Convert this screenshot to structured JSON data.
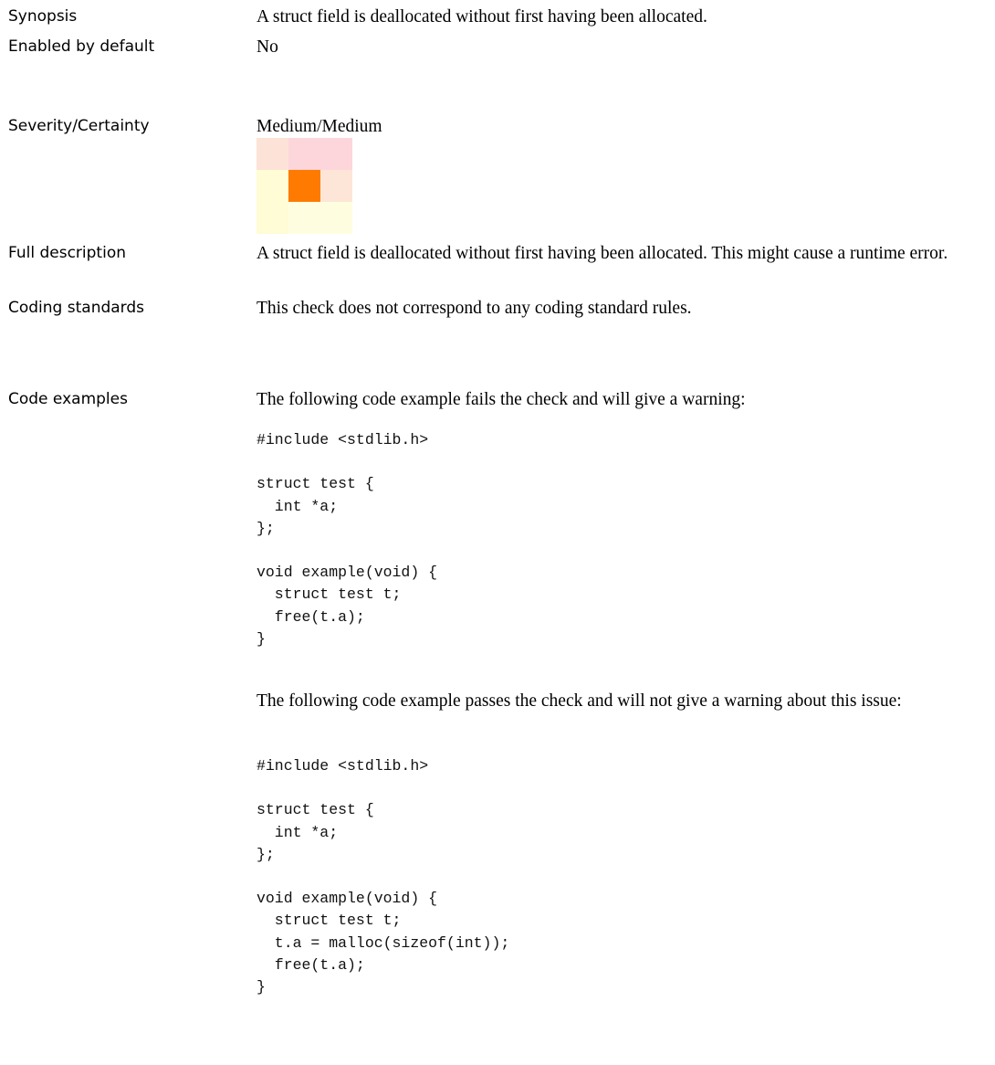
{
  "rows": {
    "synopsis": {
      "label": "Synopsis",
      "value": "A struct field is deallocated without first having been allocated."
    },
    "enabled": {
      "label": "Enabled by default",
      "value": "No"
    },
    "severity": {
      "label": "Severity/Certainty",
      "value": "Medium/Medium"
    },
    "full_description": {
      "label": "Full description",
      "value": "A struct field is deallocated without first having been allocated. This might cause a runtime error."
    },
    "coding_standards": {
      "label": "Coding standards",
      "value": "This check does not correspond to any coding standard rules."
    },
    "code_examples": {
      "label": "Code examples",
      "fail_intro": "The following code example fails the check and will give a warning:",
      "fail_code": "#include <stdlib.h>\n\nstruct test {\n  int *a;\n};\n\nvoid example(void) {\n  struct test t;\n  free(t.a);\n}",
      "pass_intro": "The following code example passes the check and will not give a warning about this issue:",
      "pass_code": "#include <stdlib.h>\n\nstruct test {\n  int *a;\n};\n\nvoid example(void) {\n  struct test t;\n  t.a = malloc(sizeof(int));\n  free(t.a);\n}"
    }
  },
  "severity_matrix": {
    "selected": "Medium/Medium",
    "colors": [
      [
        "#fde2d8",
        "#fdd6dc",
        "#fdd6dc"
      ],
      [
        "#fffcd6",
        "#ff7a00",
        "#fde6d7"
      ],
      [
        "#fffcd6",
        "#fffddf",
        "#fffddf"
      ]
    ]
  }
}
